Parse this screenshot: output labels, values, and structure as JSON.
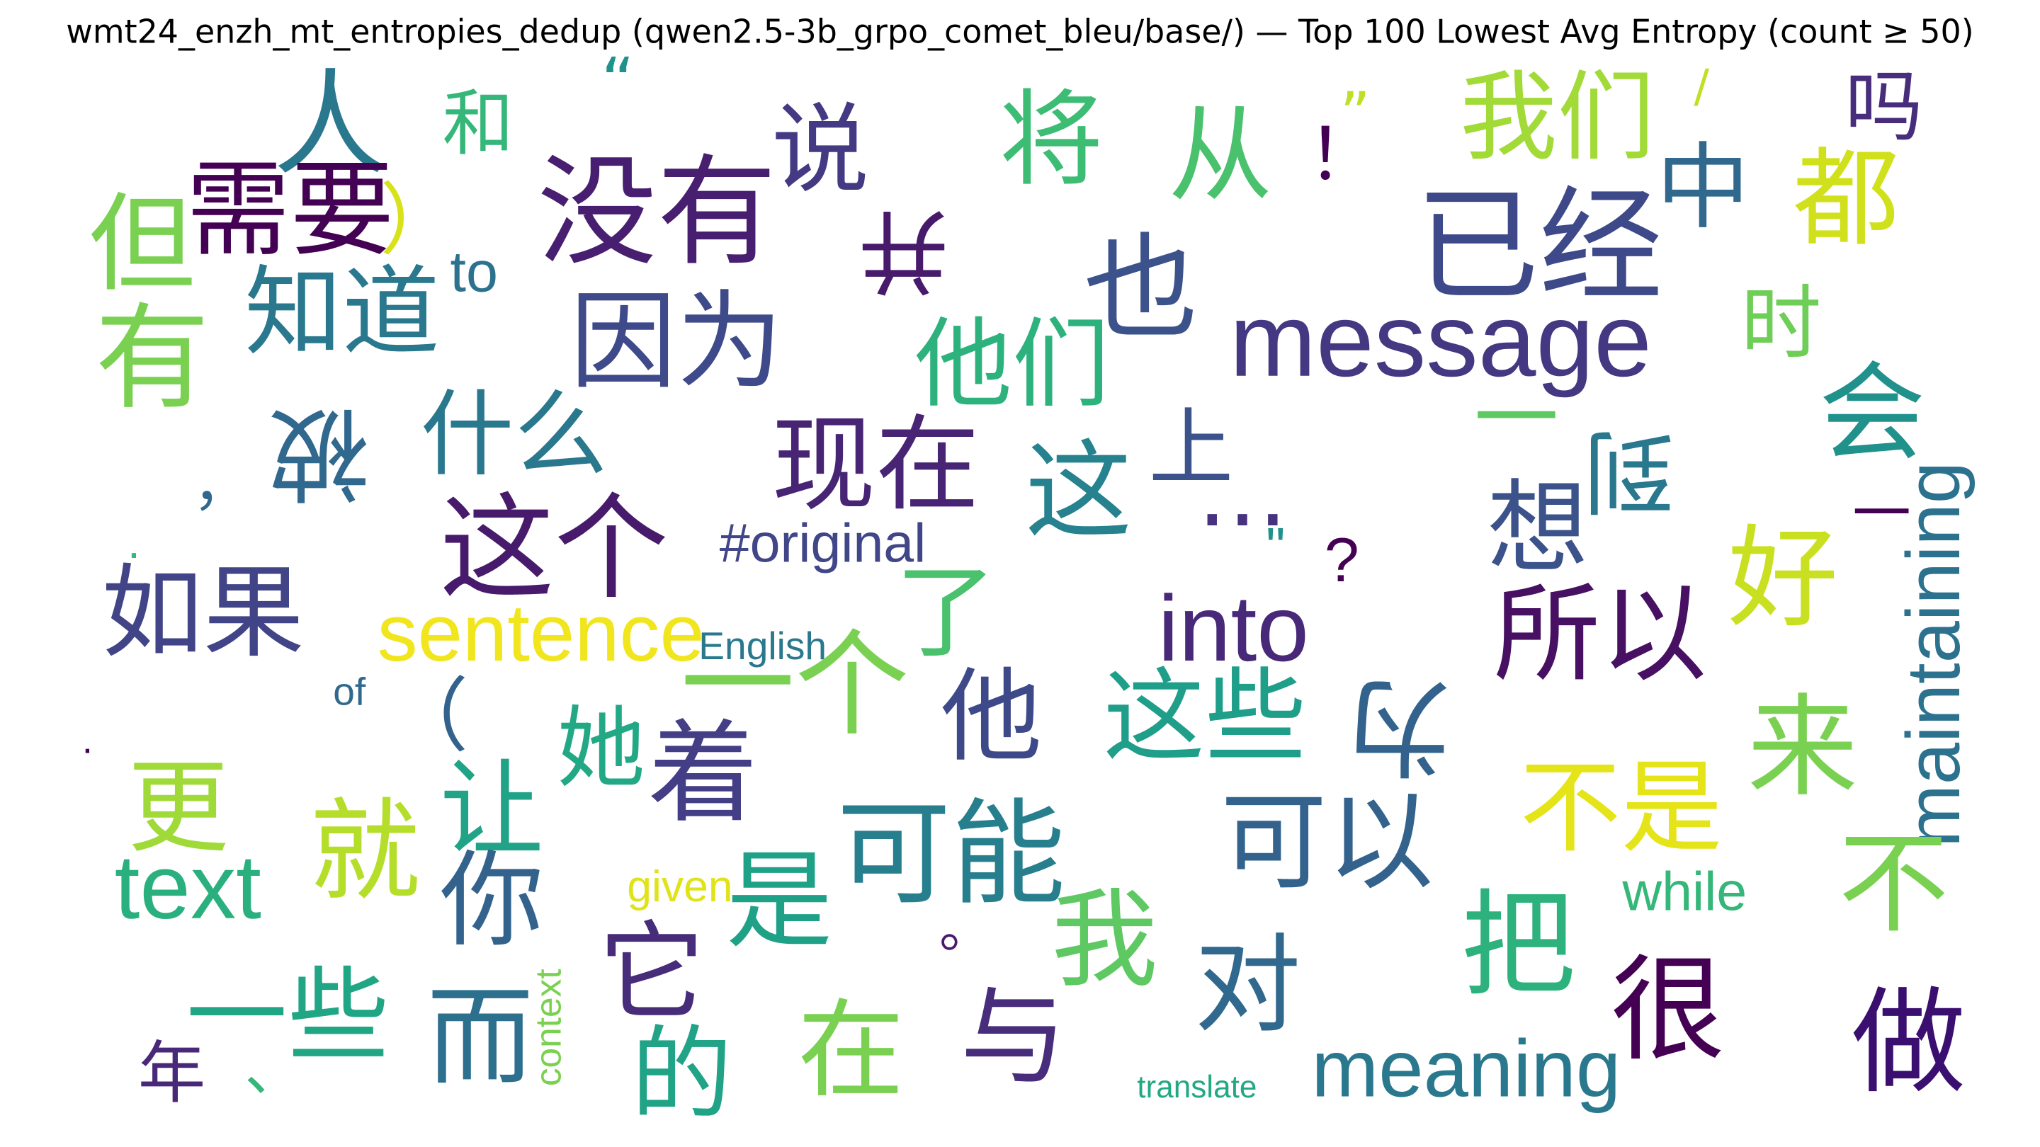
{
  "title": "wmt24_enzh_mt_entropies_dedup (qwen2.5-3b_grpo_comet_bleu/base/) — Top 100 Lowest Avg Entropy (count ≥ 50)",
  "words": [
    {
      "text": "人",
      "color": "#2a788e"
    },
    {
      "text": "“",
      "color": "#21918c"
    },
    {
      "text": "和",
      "color": "#35b779"
    },
    {
      "text": "说",
      "color": "#443983"
    },
    {
      "text": "将",
      "color": "#3dbc74"
    },
    {
      "text": "从",
      "color": "#4ac16d"
    },
    {
      "text": "！",
      "color": "#440154"
    },
    {
      "text": "”",
      "color": "#bddf26"
    },
    {
      "text": "我们",
      "color": "#a2da37"
    },
    {
      "text": "/",
      "color": "#c2df23"
    },
    {
      "text": "吗",
      "color": "#472d7b"
    },
    {
      "text": "需要",
      "color": "#440154"
    },
    {
      "text": "）",
      "color": "#d8e219"
    },
    {
      "text": "没有",
      "color": "#481f70"
    },
    {
      "text": "并",
      "color": "#481a6c",
      "rotated": true
    },
    {
      "text": "中",
      "color": "#31688e"
    },
    {
      "text": "都",
      "color": "#d0e11c"
    },
    {
      "text": "已经",
      "color": "#3e4989"
    },
    {
      "text": "但",
      "color": "#7ad151"
    },
    {
      "text": "to",
      "color": "#2c728e"
    },
    {
      "text": "也",
      "color": "#3b528b"
    },
    {
      "text": "知道",
      "color": "#2a788e"
    },
    {
      "text": "因为",
      "color": "#3e4a89"
    },
    {
      "text": "有",
      "color": "#7ad151"
    },
    {
      "text": "message",
      "color": "#453882"
    },
    {
      "text": "时",
      "color": "#6ece58"
    },
    {
      "text": "他们",
      "color": "#2db27d"
    },
    {
      "text": "会",
      "color": "#21918c"
    },
    {
      "text": "被",
      "color": "#31688e",
      "rotated": true
    },
    {
      "text": "什么",
      "color": "#2a788e"
    },
    {
      "text": "上",
      "color": "#3b528b"
    },
    {
      "text": "一",
      "color": "#5ec962"
    },
    {
      "text": "到",
      "color": "#2a788e",
      "rotated": true
    },
    {
      "text": "，",
      "color": "#31688e"
    },
    {
      "text": "现在",
      "color": "#482475"
    },
    {
      "text": "这",
      "color": "#26828e"
    },
    {
      "text": "…",
      "color": "#46327e"
    },
    {
      "text": "maintaining",
      "color": "#2c728e",
      "rotated": true
    },
    {
      "text": "一",
      "color": "#440154",
      "rotated": true
    },
    {
      "text": "这个",
      "color": "#481a6c"
    },
    {
      "text": "想",
      "color": "#3b528b"
    },
    {
      "text": "#original",
      "color": "#404688"
    },
    {
      "text": "\"",
      "color": "#21918c"
    },
    {
      "text": "?",
      "color": "#440154"
    },
    {
      "text": ".",
      "color": "#35b779"
    },
    {
      "text": "好",
      "color": "#c8e020"
    },
    {
      "text": "如果",
      "color": "#414487"
    },
    {
      "text": "了",
      "color": "#4ac16d"
    },
    {
      "text": "into",
      "color": "#482878"
    },
    {
      "text": "所以",
      "color": "#471063"
    },
    {
      "text": "sentence",
      "color": "#f1e51d"
    },
    {
      "text": "English",
      "color": "#2a788e"
    },
    {
      "text": "一个",
      "color": "#7ad151"
    },
    {
      "text": "of",
      "color": "#31688e"
    },
    {
      "text": "他",
      "color": "#3e4989"
    },
    {
      "text": "这些",
      "color": "#1f9e89"
    },
    {
      "text": "为",
      "color": "#33638d",
      "rotated": true
    },
    {
      "text": "来",
      "color": "#7ad151"
    },
    {
      "text": "（",
      "color": "#33638d"
    },
    {
      "text": ".",
      "color": "#440154"
    },
    {
      "text": "她",
      "color": "#22a884"
    },
    {
      "text": "着",
      "color": "#433e85"
    },
    {
      "text": "更",
      "color": "#a0da39"
    },
    {
      "text": "不是",
      "color": "#e5e419"
    },
    {
      "text": "让",
      "color": "#20a386"
    },
    {
      "text": "就",
      "color": "#b5de2b"
    },
    {
      "text": "可能",
      "color": "#277f8e"
    },
    {
      "text": "可以",
      "color": "#33638d"
    },
    {
      "text": "不",
      "color": "#7ad151"
    },
    {
      "text": "text",
      "color": "#2ab07f"
    },
    {
      "text": "你",
      "color": "#33638d"
    },
    {
      "text": "given",
      "color": "#dfe318"
    },
    {
      "text": "是",
      "color": "#1fa187"
    },
    {
      "text": "while",
      "color": "#35b779"
    },
    {
      "text": "把",
      "color": "#2db27d"
    },
    {
      "text": "我",
      "color": "#5ec962"
    },
    {
      "text": "。",
      "color": "#481a6c"
    },
    {
      "text": "它",
      "color": "#472c7a"
    },
    {
      "text": "对",
      "color": "#31688e"
    },
    {
      "text": "很",
      "color": "#440154"
    },
    {
      "text": "一些",
      "color": "#21a685"
    },
    {
      "text": "context",
      "color": "#7ad151",
      "rotated": true
    },
    {
      "text": "而",
      "color": "#2d708e"
    },
    {
      "text": "与",
      "color": "#472d7b"
    },
    {
      "text": "在",
      "color": "#7ad151"
    },
    {
      "text": "做",
      "color": "#3b0f70"
    },
    {
      "text": "meaning",
      "color": "#2a788e"
    },
    {
      "text": "的",
      "color": "#20a386"
    },
    {
      "text": "、",
      "color": "#35b779"
    },
    {
      "text": "年",
      "color": "#482878"
    },
    {
      "text": "translate",
      "color": "#22a884"
    }
  ]
}
